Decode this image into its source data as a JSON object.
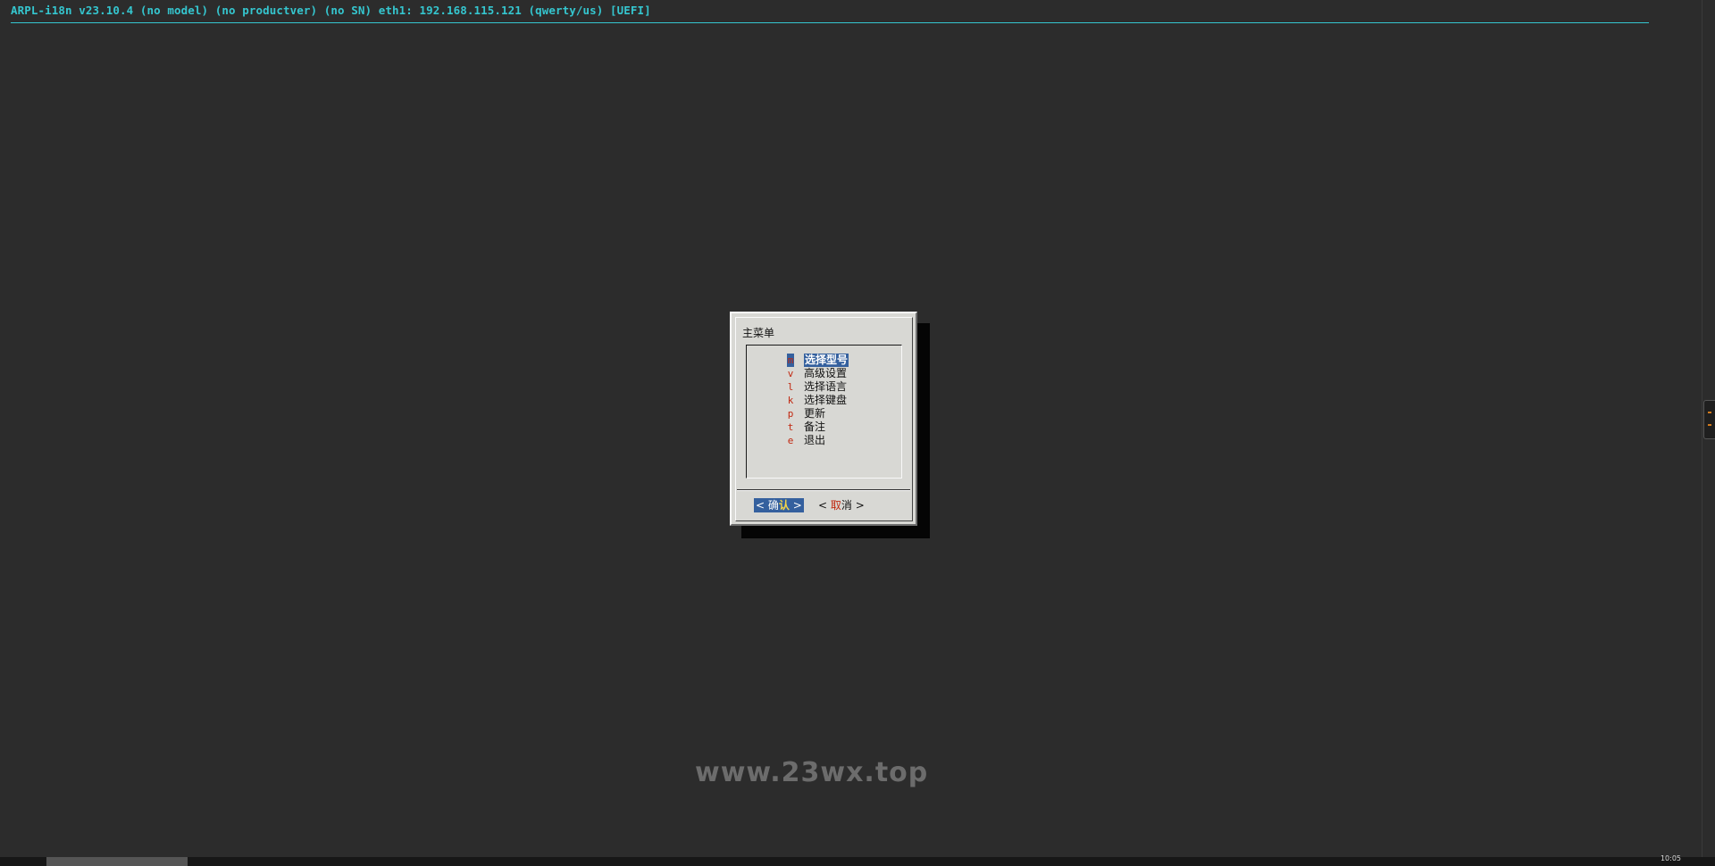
{
  "statusbar": {
    "text": "ARPL-i18n v23.10.4 (no model) (no productver) (no SN) eth1: 192.168.115.121 (qwerty/us) [UEFI]",
    "color": "#35c6cf"
  },
  "dialog": {
    "title": "主菜单",
    "items": [
      {
        "hotkey": "m",
        "label": "选择型号",
        "selected": true
      },
      {
        "hotkey": "v",
        "label": "高级设置",
        "selected": false
      },
      {
        "hotkey": "l",
        "label": "选择语言",
        "selected": false
      },
      {
        "hotkey": "k",
        "label": "选择键盘",
        "selected": false
      },
      {
        "hotkey": "p",
        "label": "更新",
        "selected": false
      },
      {
        "hotkey": "t",
        "label": "备注",
        "selected": false
      },
      {
        "hotkey": "e",
        "label": "退出",
        "selected": false
      }
    ],
    "ok_button": {
      "left": "<",
      "pre": "确",
      "hl": "认",
      "right": ">"
    },
    "cancel_button": {
      "left": "<",
      "hl": "取",
      "post": "消",
      "right": ">"
    }
  },
  "watermark": "www.23wx.top",
  "taskbar": {
    "clock": "10:05"
  },
  "colors": {
    "background": "#2c2c2c",
    "dialog": "#d8d8d4",
    "selection": "#34609e",
    "hotkey": "#c1270f"
  }
}
